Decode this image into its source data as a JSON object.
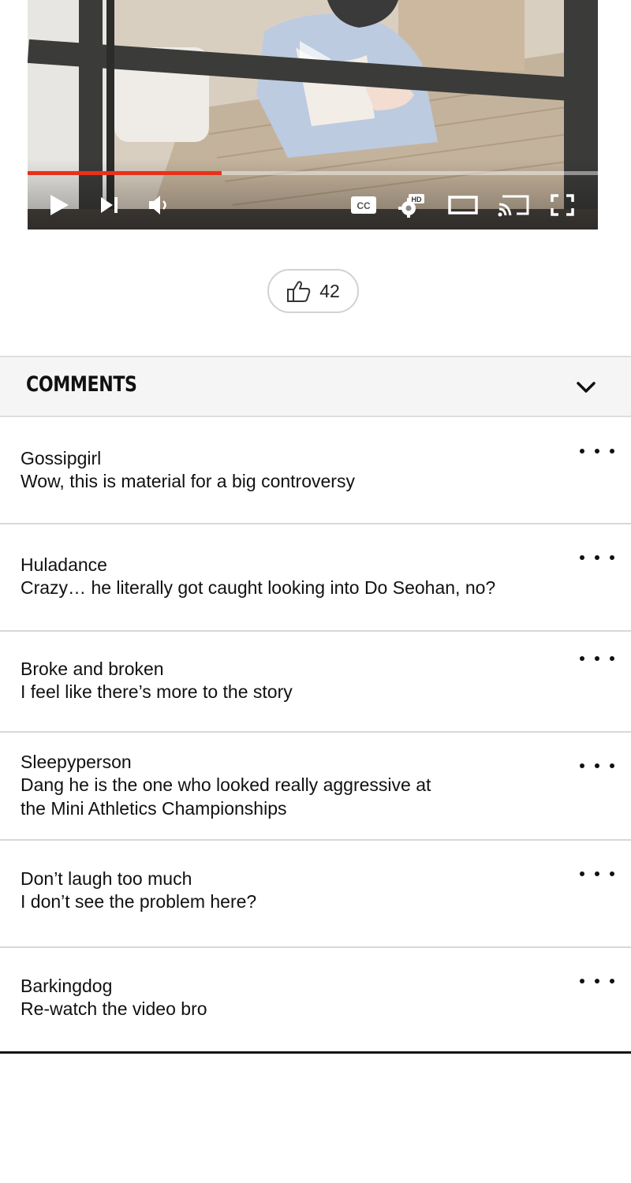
{
  "video": {
    "progress": 0.34,
    "controls": {
      "play_icon": "play-icon",
      "next_icon": "skip-next-icon",
      "volume_icon": "volume-icon",
      "cc_label": "CC",
      "quality_badge": "HD",
      "settings_icon": "gear-icon",
      "theater_icon": "theater-mode-icon",
      "cast_icon": "cast-icon",
      "fullscreen_icon": "fullscreen-icon"
    },
    "accent_color": "#e8311b"
  },
  "like": {
    "icon": "thumbs-up-icon",
    "count": "42"
  },
  "comments_section": {
    "title": "COMMENTS",
    "toggle_icon": "chevron-down-icon",
    "items": [
      {
        "author": "Gossipgirl",
        "lines": [
          "Wow, this is material for a big controversy"
        ]
      },
      {
        "author": "Huladance",
        "lines": [
          "Crazy… he literally got caught looking into Do Seohan, no?"
        ]
      },
      {
        "author": "Broke and broken",
        "lines": [
          "I feel like there’s more to the story"
        ]
      },
      {
        "author": "Sleepyperson",
        "lines": [
          "Dang he is the one who looked really aggressive at",
          "the Mini Athletics Championships"
        ]
      },
      {
        "author": "Don’t laugh too much",
        "lines": [
          "I don’t see the problem here?"
        ]
      },
      {
        "author": "Barkingdog",
        "lines": [
          "Re-watch the video bro"
        ]
      }
    ]
  }
}
